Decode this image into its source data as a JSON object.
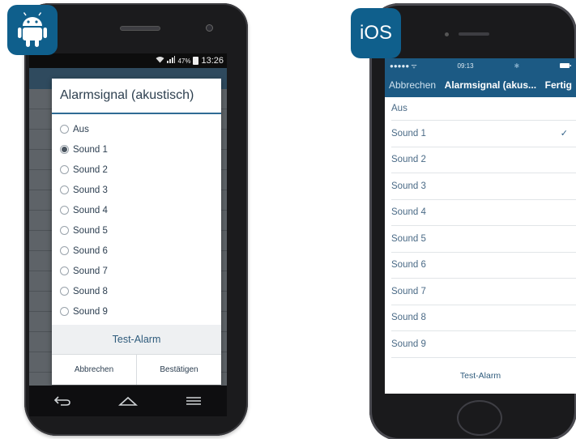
{
  "android": {
    "status_time": "13:26",
    "status_battery": "47%",
    "dialog_title": "Alarmsignal (akustisch)",
    "options": [
      "Aus",
      "Sound 1",
      "Sound 2",
      "Sound 3",
      "Sound 4",
      "Sound 5",
      "Sound 6",
      "Sound 7",
      "Sound 8",
      "Sound 9"
    ],
    "selected_option": "Sound 1",
    "test_button": "Test-Alarm",
    "cancel_button": "Abbrechen",
    "confirm_button": "Bestätigen"
  },
  "ios": {
    "badge_label": "iOS",
    "status_carrier": "●●●●● ᯤ",
    "status_time": "09:13",
    "nav_cancel": "Abbrechen",
    "nav_title": "Alarmsignal (akus...",
    "nav_done": "Fertig",
    "options": [
      "Aus",
      "Sound 1",
      "Sound 2",
      "Sound 3",
      "Sound 4",
      "Sound 5",
      "Sound 6",
      "Sound 7",
      "Sound 8",
      "Sound 9"
    ],
    "selected_option": "Sound 1",
    "test_button": "Test-Alarm"
  },
  "colors": {
    "accent": "#1c5a84",
    "badge": "#0f5f8c",
    "dialog_text": "#2c3e50"
  },
  "icons": {
    "android_badge": "android-robot-icon",
    "android_nav": [
      "back-icon",
      "home-icon",
      "menu-icon"
    ],
    "ios_check": "checkmark-icon"
  }
}
